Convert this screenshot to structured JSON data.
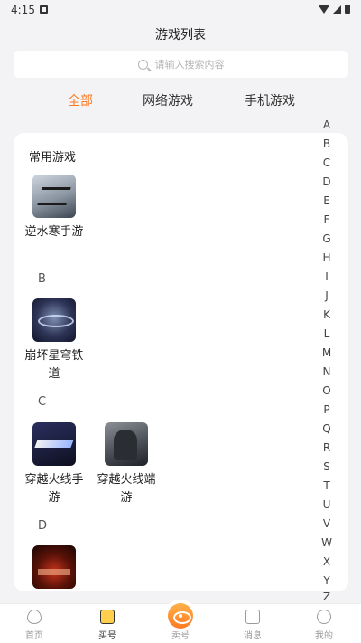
{
  "status_bar": {
    "time": "4:15"
  },
  "header": {
    "title": "游戏列表"
  },
  "search": {
    "placeholder": "请输入搜索内容"
  },
  "tabs": [
    {
      "label": "全部",
      "active": true
    },
    {
      "label": "网络游戏",
      "active": false
    },
    {
      "label": "手机游戏",
      "active": false
    }
  ],
  "sections": {
    "common": {
      "title": "常用游戏",
      "games": [
        {
          "name": "逆水寒手游",
          "icon": "nishuihan-game-icon"
        }
      ]
    },
    "B": {
      "letter": "B",
      "games": [
        {
          "name": "崩坏星穹铁道",
          "icon": "honkai-star-rail-game-icon"
        }
      ]
    },
    "C": {
      "letter": "C",
      "games": [
        {
          "name": "穿越火线手游",
          "icon": "crossfire-mobile-game-icon"
        },
        {
          "name": "穿越火线端游",
          "icon": "crossfire-pc-game-icon"
        }
      ]
    },
    "D": {
      "letter": "D",
      "games": [
        {
          "name": "",
          "icon": "d-game-icon"
        }
      ]
    }
  },
  "alphabet": [
    "A",
    "B",
    "C",
    "D",
    "E",
    "F",
    "G",
    "H",
    "I",
    "J",
    "K",
    "L",
    "M",
    "N",
    "O",
    "P",
    "Q",
    "R",
    "S",
    "T",
    "U",
    "V",
    "W",
    "X",
    "Y",
    "Z"
  ],
  "bottom_nav": [
    {
      "label": "首页",
      "icon": "home-icon",
      "active": false
    },
    {
      "label": "买号",
      "icon": "buy-icon",
      "active": true
    },
    {
      "label": "卖号",
      "icon": "sell-icon",
      "active": false
    },
    {
      "label": "消息",
      "icon": "message-icon",
      "active": false
    },
    {
      "label": "我的",
      "icon": "profile-icon",
      "active": false
    }
  ],
  "colors": {
    "accent": "#ff7a22",
    "background": "#f3f3f5",
    "card": "#ffffff"
  }
}
